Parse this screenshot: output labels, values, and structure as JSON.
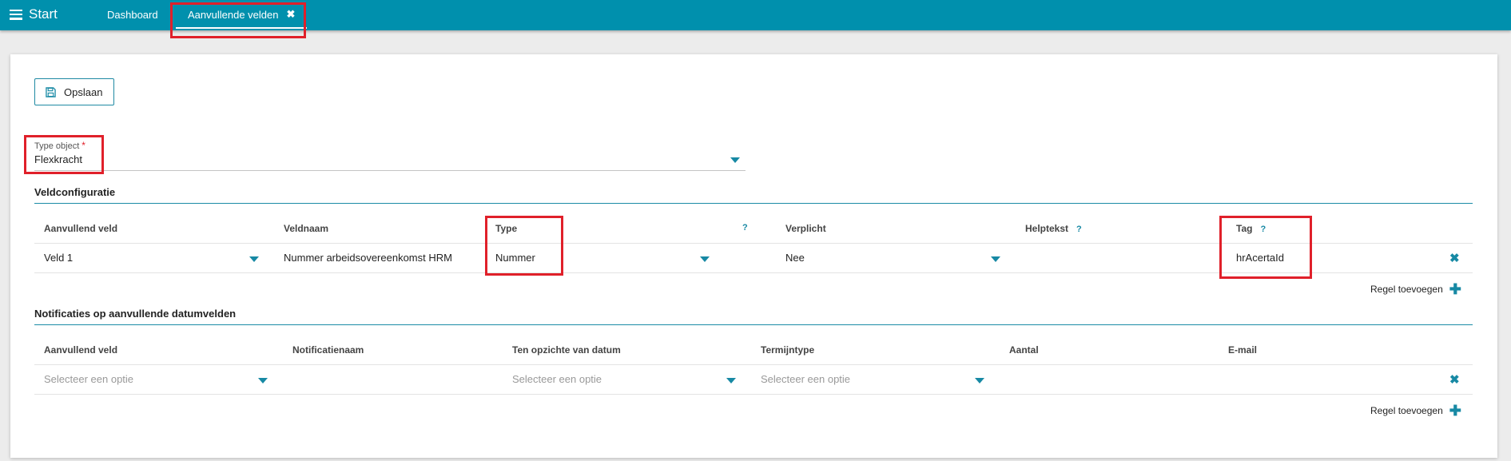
{
  "topbar": {
    "menu_label": "Start",
    "tabs": [
      {
        "label": "Dashboard"
      },
      {
        "label": "Aanvullende velden",
        "close": "✖"
      }
    ]
  },
  "toolbar": {
    "save_label": "Opslaan"
  },
  "type_object": {
    "label": "Type object",
    "required_mark": "*",
    "value": "Flexkracht"
  },
  "veldconfiguratie": {
    "title": "Veldconfiguratie",
    "columns": [
      "Aanvullend veld",
      "Veldnaam",
      "Type",
      "Verplicht",
      "Helptekst",
      "Tag"
    ],
    "help_mark": "?",
    "rows": [
      {
        "aanvullend_veld": "Veld 1",
        "veldnaam": "Nummer arbeidsovereenkomst HRM",
        "type": "Nummer",
        "verplicht": "Nee",
        "helptekst": "",
        "tag": "hrAcertaId"
      }
    ],
    "add_label": "Regel toevoegen"
  },
  "notificaties": {
    "title": "Notificaties op aanvullende datumvelden",
    "columns": [
      "Aanvullend veld",
      "Notificatienaam",
      "Ten opzichte van datum",
      "Termijntype",
      "Aantal",
      "E-mail"
    ],
    "rows": [
      {
        "aanvullend_veld": "Selecteer een optie",
        "ten_opzichte": "Selecteer een optie",
        "termijntype": "Selecteer een optie"
      }
    ],
    "add_label": "Regel toevoegen"
  },
  "icons": {
    "delete": "✖",
    "add": "✚",
    "save": "save-icon"
  },
  "colors": {
    "topbar": "#0090ad",
    "accent": "#1789a4",
    "highlight": "#e0202a"
  }
}
